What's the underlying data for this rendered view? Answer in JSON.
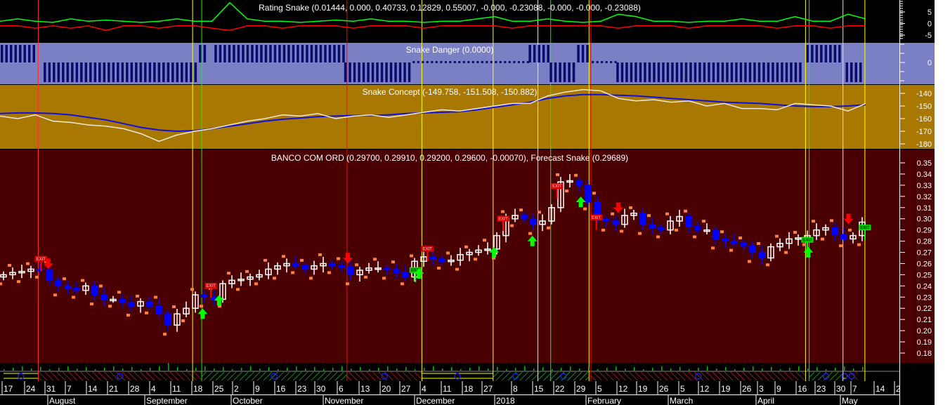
{
  "colors": {
    "rating_bg": "#000000",
    "danger_bg": "#7b7fc4",
    "danger_bar": "#0a0a6e",
    "concept_bg": "#a87800",
    "price_bg": "#4a0000",
    "up_candle": "#ffffff",
    "down_candle": "#0000ff",
    "signal_dot": "#ff7f3f",
    "buy": "#00ff00",
    "sell": "#ff0000",
    "line_yellow": "#ffff00",
    "concept_blue": "#1010e0",
    "concept_white": "#f0e8d8"
  },
  "chart_data": [
    {
      "type": "line",
      "title": "Rating Snake (0.01444, 0.000, 0.40733, 0.12829, 0.55007, -0.000, -0.23088, -0.000, -0.000, -0.23088)",
      "ylim": [
        -7,
        10
      ],
      "yticks": [
        "5",
        "0",
        "-5"
      ],
      "ytick_values": [
        5,
        0,
        -5
      ],
      "series": [
        {
          "name": "rating-positive",
          "color": "#00ff00",
          "values": [
            1,
            2,
            1,
            0.5,
            2,
            1,
            1.5,
            1,
            0.5,
            1,
            2,
            1,
            1,
            9,
            2,
            1,
            1,
            0.5,
            1,
            1.5,
            1,
            2,
            1,
            1,
            0.5,
            1,
            1,
            2,
            3,
            1,
            1,
            2,
            1,
            0.5,
            1,
            4,
            3,
            1,
            1,
            0.5,
            1,
            1,
            2,
            1,
            1,
            3,
            1,
            1,
            4,
            2
          ]
        },
        {
          "name": "rating-negative",
          "color": "#ff0000",
          "values": [
            -1,
            -1,
            -2,
            -1,
            -2,
            -1,
            -3,
            -1,
            -1,
            -2,
            -1,
            -1,
            -2,
            -3,
            -1,
            -1,
            -2,
            -1,
            -1,
            -1,
            -2,
            -1,
            -1,
            -1,
            -2,
            -1,
            -1,
            -1,
            -1,
            -2,
            -1,
            -1,
            -1,
            -1,
            -1,
            -2,
            -1,
            -1,
            -1,
            -2,
            -1,
            -1,
            -1,
            -1,
            -2,
            -1,
            -1,
            -2,
            -1,
            -1
          ]
        }
      ]
    },
    {
      "type": "bar",
      "title": "Snake Danger (0.0000)",
      "yticks": [
        "0"
      ],
      "segments": [
        {
          "from": 0,
          "to": 3.8,
          "state": 1
        },
        {
          "from": 4.7,
          "to": 21.6,
          "state": -1
        },
        {
          "from": 21.7,
          "to": 22.7,
          "state": 1
        },
        {
          "from": 23.4,
          "to": 37.5,
          "state": 1
        },
        {
          "from": 37.6,
          "to": 45,
          "state": -1
        },
        {
          "from": 45.1,
          "to": 57.7,
          "state": 0
        },
        {
          "from": 57.8,
          "to": 60,
          "state": 1
        },
        {
          "from": 60.1,
          "to": 63,
          "state": -1
        },
        {
          "from": 63.1,
          "to": 64.6,
          "state": 1
        },
        {
          "from": 64.7,
          "to": 67.3,
          "state": 0
        },
        {
          "from": 67.4,
          "to": 87.8,
          "state": -1
        },
        {
          "from": 88.2,
          "to": 92.2,
          "state": 1
        },
        {
          "from": 92.5,
          "to": 94.3,
          "state": -1
        }
      ]
    },
    {
      "type": "line",
      "title": "Snake Concept (-149.758, -151.508, -150.882)",
      "ylim": [
        -185,
        -133
      ],
      "yticks": [
        "-140",
        "-150",
        "-160",
        "-170",
        "-180"
      ],
      "ytick_values": [
        -140,
        -150,
        -160,
        -170,
        -180
      ],
      "series": [
        {
          "name": "concept-blue",
          "color": "#1010e0",
          "values": [
            -156,
            -155.5,
            -155.5,
            -156,
            -157,
            -159,
            -161,
            -164,
            -167,
            -169,
            -170,
            -169.5,
            -168,
            -166,
            -164,
            -162,
            -160.5,
            -159.5,
            -158.5,
            -158,
            -157.5,
            -157.5,
            -157,
            -156,
            -155.5,
            -155,
            -154.5,
            -153,
            -151,
            -149,
            -147,
            -144,
            -142,
            -141,
            -141,
            -141.5,
            -142,
            -143,
            -144,
            -145,
            -146,
            -147,
            -147.5,
            -148,
            -149,
            -150,
            -150.5,
            -150.5,
            -150,
            -149
          ]
        },
        {
          "name": "concept-white",
          "color": "#f0e8d8",
          "values": [
            -158,
            -160,
            -157,
            -162,
            -163,
            -165,
            -166,
            -168,
            -172,
            -178,
            -173,
            -170,
            -168,
            -165,
            -162,
            -160,
            -157,
            -158,
            -156,
            -160,
            -158,
            -157,
            -159,
            -157,
            -155,
            -153,
            -154,
            -152,
            -150,
            -148,
            -148,
            -142,
            -139,
            -137,
            -138,
            -144,
            -146,
            -145,
            -147,
            -146,
            -150,
            -148,
            -152,
            -152,
            -153,
            -148,
            -149,
            -150,
            -154,
            -148
          ]
        }
      ]
    },
    {
      "type": "candlestick",
      "title": "BANCO COM ORD (0.29700, 0.29910, 0.29200, 0.29600, -0.00070), Forecast Snake (0.29689)",
      "ylim": [
        0.17,
        0.36
      ],
      "yticks": [
        "0.35",
        "0.34",
        "0.33",
        "0.32",
        "0.31",
        "0.30",
        "0.29",
        "0.28",
        "0.27",
        "0.26",
        "0.25",
        "0.24",
        "0.23",
        "0.22",
        "0.21",
        "0.20",
        "0.19",
        "0.18"
      ],
      "ytick_values": [
        0.35,
        0.34,
        0.33,
        0.32,
        0.31,
        0.3,
        0.29,
        0.28,
        0.27,
        0.26,
        0.25,
        0.24,
        0.23,
        0.22,
        0.21,
        0.2,
        0.19,
        0.18
      ],
      "closes": [
        0.25,
        0.252,
        0.253,
        0.255,
        0.254,
        0.245,
        0.24,
        0.238,
        0.236,
        0.24,
        0.232,
        0.228,
        0.228,
        0.225,
        0.222,
        0.226,
        0.222,
        0.215,
        0.205,
        0.215,
        0.22,
        0.232,
        0.23,
        0.228,
        0.242,
        0.245,
        0.246,
        0.248,
        0.25,
        0.255,
        0.258,
        0.26,
        0.258,
        0.255,
        0.258,
        0.26,
        0.258,
        0.257,
        0.25,
        0.254,
        0.256,
        0.256,
        0.255,
        0.252,
        0.248,
        0.262,
        0.266,
        0.264,
        0.262,
        0.263,
        0.268,
        0.27,
        0.272,
        0.273,
        0.285,
        0.3,
        0.303,
        0.3,
        0.295,
        0.298,
        0.31,
        0.333,
        0.334,
        0.33,
        0.315,
        0.3,
        0.298,
        0.295,
        0.303,
        0.305,
        0.295,
        0.292,
        0.29,
        0.298,
        0.302,
        0.293,
        0.29,
        0.29,
        0.282,
        0.28,
        0.278,
        0.276,
        0.27,
        0.265,
        0.275,
        0.278,
        0.282,
        0.283,
        0.285,
        0.29,
        0.292,
        0.286,
        0.282,
        0.285,
        0.297
      ],
      "vertical_lines": [
        {
          "bar": 3.8,
          "color": "#ff3030"
        },
        {
          "bar": 20.7,
          "color": "#ffff00"
        },
        {
          "bar": 21.7,
          "color": "#00ff00"
        },
        {
          "bar": 37.6,
          "color": "#ff0000"
        },
        {
          "bar": 45.8,
          "color": "#ffff00"
        },
        {
          "bar": 53.6,
          "color": "#ffff00"
        },
        {
          "bar": 58.5,
          "color": "#ffff00"
        },
        {
          "bar": 59.9,
          "color": "#00ff00"
        },
        {
          "bar": 64.1,
          "color": "#ffff00"
        },
        {
          "bar": 64.3,
          "color": "#ff0000"
        },
        {
          "bar": 87.8,
          "color": "#ffff00"
        },
        {
          "bar": 88.2,
          "color": "#00ff00"
        },
        {
          "bar": 91.9,
          "color": "#ffd0d0"
        },
        {
          "bar": 94.3,
          "color": "#ffff00"
        }
      ],
      "exit_label": "EXIT",
      "exit_signals": [
        {
          "bar": 4.1,
          "price": 0.262,
          "color": "#ff0000"
        },
        {
          "bar": 22.7,
          "price": 0.238,
          "color": "#ff0000"
        },
        {
          "bar": 46.4,
          "price": 0.271,
          "color": "#ff0000"
        },
        {
          "bar": 54.7,
          "price": 0.298,
          "color": "#ff0000"
        },
        {
          "bar": 60.6,
          "price": 0.327,
          "color": "#ff0000"
        },
        {
          "bar": 64.9,
          "price": 0.299,
          "color": "#ff0000"
        },
        {
          "bar": 45.1,
          "price": 0.252,
          "color": "#00ff00"
        },
        {
          "bar": 88.0,
          "price": 0.279,
          "color": "#00ff00"
        },
        {
          "bar": 94.3,
          "price": 0.29,
          "color": "#00ff00"
        }
      ],
      "sell_arrows": [
        4.9,
        37.7,
        67.3,
        92.5
      ],
      "buy_arrows": [
        21.8,
        23.6,
        45.5,
        53.7,
        57.9,
        63.2,
        88.1
      ],
      "forecast": 0.29689
    }
  ],
  "x_axis": {
    "days": [
      "17",
      "24",
      "31",
      "7",
      "14",
      "21",
      "28",
      "4",
      "11",
      "18",
      "25",
      "2",
      "9",
      "16",
      "23",
      "30",
      "6",
      "13",
      "20",
      "27",
      "4",
      "11",
      "18",
      "27",
      "8",
      "15",
      "22",
      "29",
      "5",
      "12",
      "19",
      "26",
      "5",
      "12",
      "19",
      "26",
      "3",
      "9",
      "16",
      "23",
      "30",
      "7",
      "14",
      "2"
    ],
    "months": [
      "August",
      "September",
      "October",
      "November",
      "December",
      "2018",
      "February",
      "March",
      "April",
      "May"
    ]
  },
  "status": {
    "face_icon": "neutral-face"
  }
}
